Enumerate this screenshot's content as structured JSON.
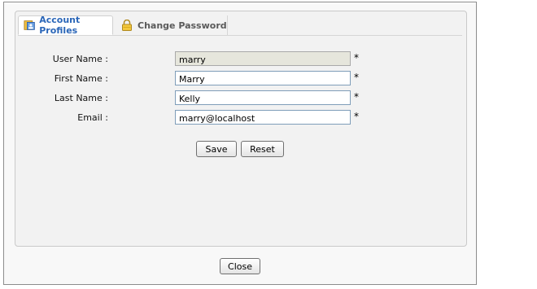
{
  "tabs": {
    "account_profiles": "Account Profiles",
    "change_password": "Change Password"
  },
  "form": {
    "fields": [
      {
        "label": "User Name :",
        "value": "marry"
      },
      {
        "label": "First Name :",
        "value": "Marry"
      },
      {
        "label": "Last Name :",
        "value": "Kelly"
      },
      {
        "label": "Email :",
        "value": "marry@localhost"
      }
    ],
    "required_marker": "*",
    "save_label": "Save",
    "reset_label": "Reset"
  },
  "footer": {
    "close_label": "Close"
  },
  "icons": {
    "account_profiles": "account-card-icon",
    "change_password": "lock-icon"
  },
  "colors": {
    "active_tab_text": "#2a66b8",
    "readonly_field_bg": "#e6e6dc"
  }
}
